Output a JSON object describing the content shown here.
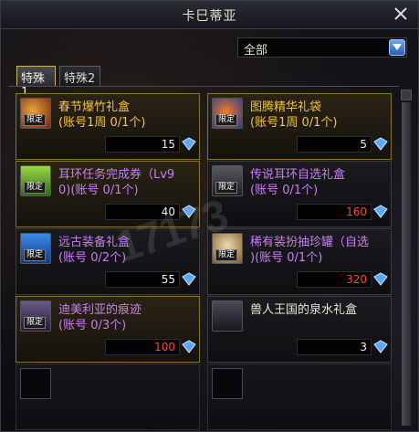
{
  "window": {
    "title": "卡巳蒂亚"
  },
  "filter": {
    "selected": "全部"
  },
  "tabs": [
    {
      "label": "特殊1",
      "active": true
    },
    {
      "label": "特殊2",
      "active": false
    }
  ],
  "items": [
    {
      "name": "春节爆竹礼盒",
      "detail": "(账号1周 0/1个)",
      "price": "15",
      "tag": "限定",
      "icon": "firecracker-box-icon",
      "name_color": "gold"
    },
    {
      "name": "图腾精华礼袋",
      "detail": "(账号1周 0/1个)",
      "price": "5",
      "tag": "限定",
      "icon": "totem-bag-icon",
      "name_color": "gold"
    },
    {
      "name": "耳环任务完成券（Lv9",
      "detail": "0)(账号 0/1个)",
      "price": "40",
      "tag": "限定",
      "icon": "quest-ticket-icon",
      "name_color": "purple"
    },
    {
      "name": "传说耳环自选礼盒",
      "detail": "(账号 0/1个)",
      "price": "160",
      "tag": "限定",
      "icon": "earring-box-icon",
      "name_color": "purple",
      "price_color": "red"
    },
    {
      "name": "远古装备礼盒",
      "detail": "(账号 0/2个)",
      "price": "55",
      "tag": "限定",
      "icon": "ancient-gear-box-icon",
      "name_color": "purple"
    },
    {
      "name": "稀有装扮抽珍罐（自选",
      "detail": ")(账号 0/1个)",
      "price": "320",
      "tag": "限定",
      "icon": "avatar-jar-icon",
      "name_color": "purple",
      "price_color": "red"
    },
    {
      "name": "迪美利亚的痕迹",
      "detail": "(账号 0/3个)",
      "price": "100",
      "tag": "限定",
      "icon": "trace-box-icon",
      "name_color": "purple",
      "price_color": "red"
    },
    {
      "name": "兽人王国的泉水礼盒",
      "detail": "",
      "price": "3",
      "tag": "",
      "icon": "spring-box-icon",
      "name_color": "white"
    }
  ],
  "watermark": "17173"
}
